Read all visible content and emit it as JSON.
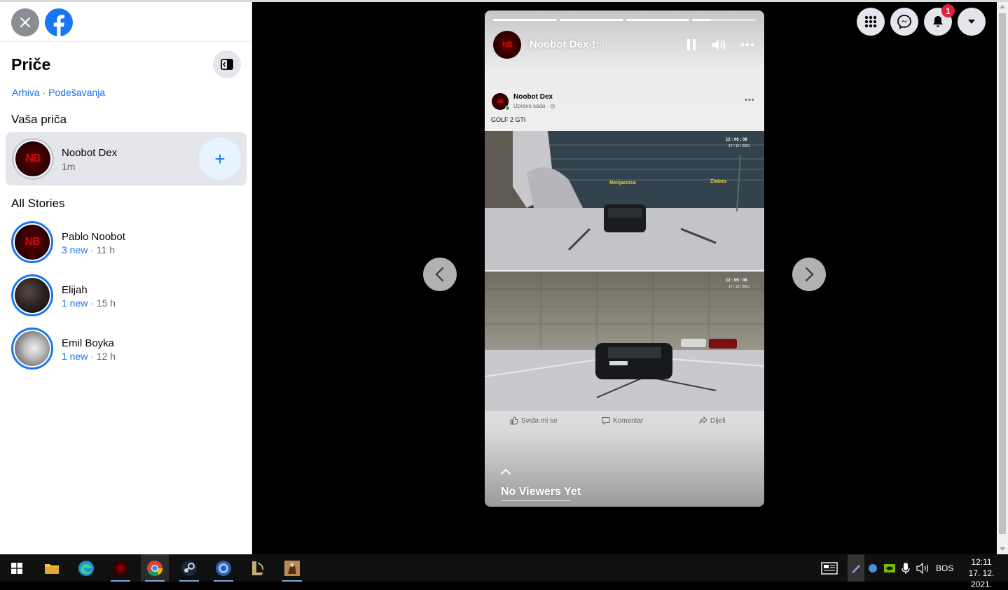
{
  "sidebar": {
    "title": "Priče",
    "links": [
      "Arhiva",
      "Podešavanja"
    ],
    "your_story_label": "Vaša priča",
    "your_story": {
      "name": "Noobot Dex",
      "time": "1m",
      "add_symbol": "+"
    },
    "all_stories_label": "All Stories",
    "stories": [
      {
        "name": "Pablo Noobot",
        "new": "3 new",
        "time": "· 11 h"
      },
      {
        "name": "Elijah",
        "new": "1 new",
        "time": "· 15 h"
      },
      {
        "name": "Emil Boyka",
        "new": "1 new",
        "time": "· 12 h"
      }
    ]
  },
  "topbar": {
    "icons": [
      "menu-grid-icon",
      "messenger-icon",
      "bell-icon",
      "caret-down-icon"
    ],
    "notification_count": "1"
  },
  "viewer": {
    "progress_fractions": [
      1,
      1,
      1,
      0.3
    ],
    "author": "Noobot Dex",
    "time": "1m",
    "post": {
      "author": "Noobot Dex",
      "meta": "Upravo sada · ",
      "text": "GOLF 2 GTI",
      "img1_signs": [
        "Menjacnica",
        "Zlatara"
      ],
      "hud_time": "12 : 06 : 08",
      "hud_date": "17 / 12 / 2021",
      "actions": [
        "Sviđa mi se",
        "Komentar",
        "Dijeli"
      ]
    },
    "no_viewers": "No Viewers Yet"
  },
  "taskbar": {
    "lang": "BOS",
    "time": "12:11",
    "date": "17. 12. 2021."
  }
}
